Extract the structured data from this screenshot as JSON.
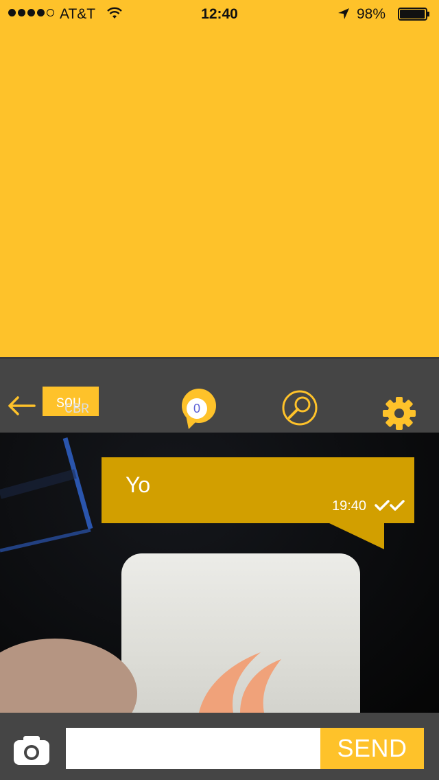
{
  "status_bar": {
    "carrier": "AT&T",
    "time": "12:40",
    "battery_percent": "98%",
    "battery_level": 0.98,
    "signal_bars_filled": 4,
    "signal_bars_total": 5
  },
  "nav": {
    "logo_line1": "SOU",
    "logo_line2": "CBR",
    "unread_count": "0",
    "icons": [
      "back-arrow-icon",
      "chat-bubble-icon",
      "search-icon",
      "gear-icon"
    ]
  },
  "message": {
    "text": "Yo",
    "time": "19:40",
    "status_icon": "double-check-icon"
  },
  "composer": {
    "input_value": "",
    "input_placeholder": "",
    "send_label": "SEND",
    "camera_icon": "camera-icon"
  },
  "colors": {
    "accent": "#FEC22A",
    "bubble": "#D29F00",
    "bar": "#454545"
  }
}
